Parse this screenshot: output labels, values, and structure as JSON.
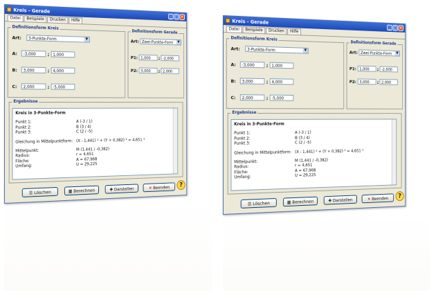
{
  "window": {
    "title": "Kreis - Gerade"
  },
  "menu": [
    "Datei",
    "Beispiele",
    "Drucken",
    "Hilfe"
  ],
  "kreis": {
    "title": "Definitionsform Kreis",
    "art_label": "Art:",
    "art_value": "3-Punkte-Form",
    "points": [
      {
        "label": "A:",
        "x": "-3,000",
        "y": "1,000"
      },
      {
        "label": "B:",
        "x": "3,000",
        "y": "4,000"
      },
      {
        "label": "C:",
        "x": "2,000",
        "y": "-5,000"
      }
    ],
    "separator": ";"
  },
  "gerade": {
    "title": "Definitionsform Gerade",
    "art_label": "Art:",
    "art_value": "Zwei-Punkte-Form",
    "points": [
      {
        "label": "P1:",
        "x": "1,000",
        "y": "-2,000"
      },
      {
        "label": "P2:",
        "x": "3,000",
        "y": "2,000"
      }
    ],
    "separator": ";"
  },
  "results": {
    "title": "Ergebnisse",
    "heading": "Kreis in 3-Punkte-Form",
    "punkte": [
      {
        "k": "Punkt 1:",
        "v": "A (-3 / 1)"
      },
      {
        "k": "Punkt 2:",
        "v": "B (3 / 4)"
      },
      {
        "k": "Punkt 3:",
        "v": "C (2 / -5)"
      }
    ],
    "gleichung": {
      "k": "Gleichung in Mittelpunktform:",
      "v": "(X - 1,441) ² + (Y + 0,382) ² = 4,651 ²"
    },
    "werte": [
      {
        "k": "Mittelpunkt:",
        "v": "M (1,441 / -0,382)"
      },
      {
        "k": "Radius:",
        "v": "r = 4,651"
      },
      {
        "k": "Fläche:",
        "v": "A = 67,968"
      },
      {
        "k": "Umfang:",
        "v": "U = 29,225"
      }
    ]
  },
  "buttons": {
    "loeschen": "Löschen",
    "berechnen": "Berechnen",
    "darstellen": "Darstellen",
    "beenden": "Beenden",
    "help": "?"
  }
}
